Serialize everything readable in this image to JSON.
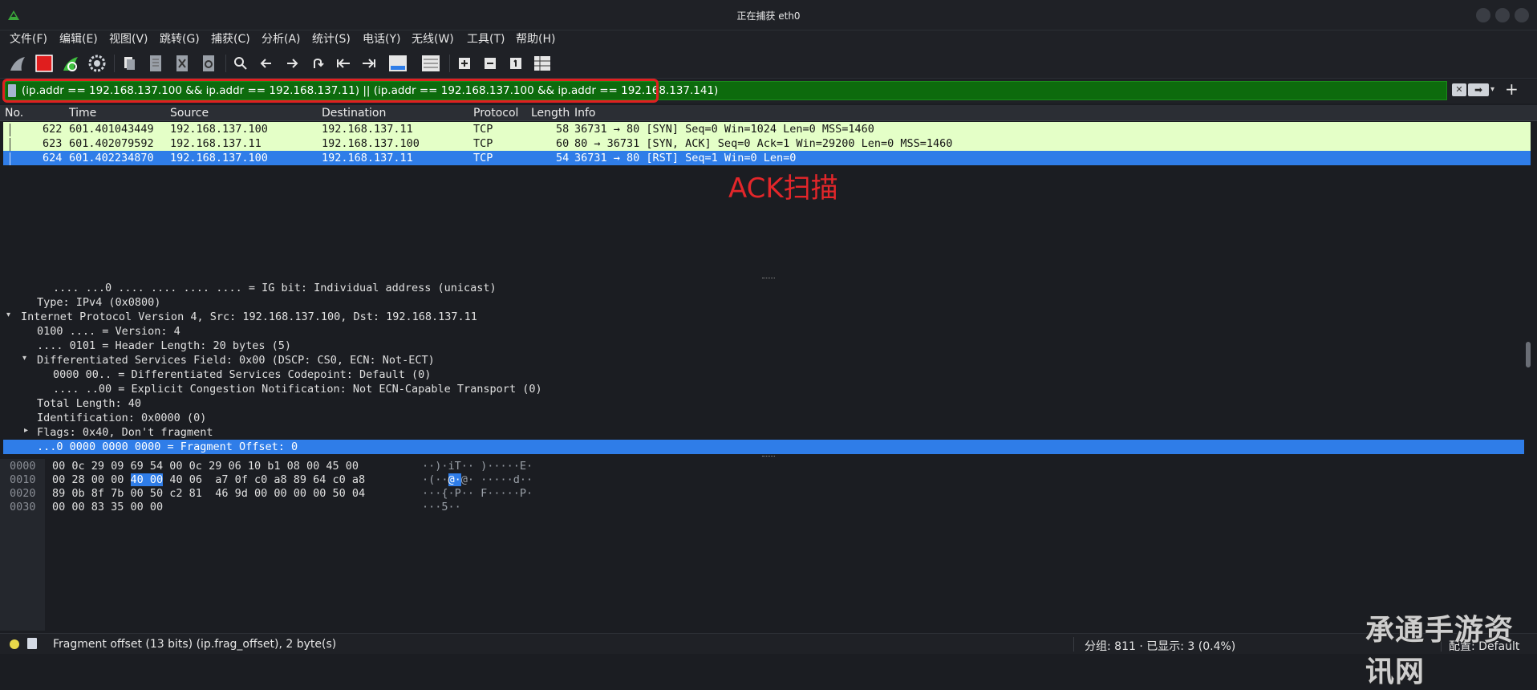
{
  "window": {
    "title": "正在捕获 eth0"
  },
  "menu": [
    "文件(F)",
    "编辑(E)",
    "视图(V)",
    "跳转(G)",
    "捕获(C)",
    "分析(A)",
    "统计(S)",
    "电话(Y)",
    "无线(W)",
    "工具(T)",
    "帮助(H)"
  ],
  "toolbar": {
    "buttons": [
      "start-capture",
      "stop-capture",
      "restart-capture",
      "capture-options",
      "open-file",
      "save-file",
      "close-file",
      "reload-file",
      "find-packet",
      "go-back",
      "go-forward",
      "go-to-packet",
      "first-packet",
      "last-packet",
      "auto-scroll",
      "colorize",
      "zoom-in",
      "zoom-out",
      "normal-size",
      "resize-columns"
    ]
  },
  "filter": {
    "value": "(ip.addr == 192.168.137.100 && ip.addr == 192.168.137.11) || (ip.addr == 192.168.137.100 && ip.addr == 192.168.137.141)",
    "accent": "#0d6b0d",
    "highlight_color": "#e02020"
  },
  "packet_list": {
    "columns": [
      "No.",
      "Time",
      "Source",
      "Destination",
      "Protocol",
      "Length",
      "Info"
    ],
    "rows": [
      {
        "no": "622",
        "time": "601.401043449",
        "source": "192.168.137.100",
        "destination": "192.168.137.11",
        "protocol": "TCP",
        "length": "58",
        "info": "36731 → 80 [SYN] Seq=0 Win=1024 Len=0 MSS=1460",
        "state": "green"
      },
      {
        "no": "623",
        "time": "601.402079592",
        "source": "192.168.137.11",
        "destination": "192.168.137.100",
        "protocol": "TCP",
        "length": "60",
        "info": "80 → 36731 [SYN, ACK] Seq=0 Ack=1 Win=29200 Len=0 MSS=1460",
        "state": "green"
      },
      {
        "no": "624",
        "time": "601.402234870",
        "source": "192.168.137.100",
        "destination": "192.168.137.11",
        "protocol": "TCP",
        "length": "54",
        "info": "36731 → 80 [RST] Seq=1 Win=0 Len=0",
        "state": "selected"
      }
    ]
  },
  "annotation": {
    "text": "ACK扫描",
    "color": "#e3262a"
  },
  "details": [
    {
      "indent": 3,
      "arrow": "",
      "text": ".... ...0 .... .... .... .... = IG bit: Individual address (unicast)"
    },
    {
      "indent": 2,
      "arrow": "",
      "text": "Type: IPv4 (0x0800)"
    },
    {
      "indent": 1,
      "arrow": "▾",
      "text": "Internet Protocol Version 4, Src: 192.168.137.100, Dst: 192.168.137.11"
    },
    {
      "indent": 2,
      "arrow": "",
      "text": "0100 .... = Version: 4"
    },
    {
      "indent": 2,
      "arrow": "",
      "text": ".... 0101 = Header Length: 20 bytes (5)"
    },
    {
      "indent": 2,
      "arrow": "▾",
      "text": "Differentiated Services Field: 0x00 (DSCP: CS0, ECN: Not-ECT)"
    },
    {
      "indent": 3,
      "arrow": "",
      "text": "0000 00.. = Differentiated Services Codepoint: Default (0)"
    },
    {
      "indent": 3,
      "arrow": "",
      "text": ".... ..00 = Explicit Congestion Notification: Not ECN-Capable Transport (0)"
    },
    {
      "indent": 2,
      "arrow": "",
      "text": "Total Length: 40"
    },
    {
      "indent": 2,
      "arrow": "",
      "text": "Identification: 0x0000 (0)"
    },
    {
      "indent": 2,
      "arrow": "▸",
      "text": "Flags: 0x40, Don't fragment"
    },
    {
      "indent": 2,
      "arrow": "",
      "text": "...0 0000 0000 0000 = Fragment Offset: 0",
      "selected": true
    }
  ],
  "bytes": [
    {
      "offset": "0000",
      "hex_a": "00 0c 29 09 69 54 00 0c  29 06 10 b1 08 00 45 00",
      "hex_hl": "",
      "hex_b": "",
      "ascii_a": "··)·iT·· )·····E·",
      "ascii_hl": "",
      "ascii_b": ""
    },
    {
      "offset": "0010",
      "hex_a": "00 28 00 00 ",
      "hex_hl": "40 00",
      "hex_b": " 40 06  a7 0f c0 a8 89 64 c0 a8",
      "ascii_a": "·(··",
      "ascii_hl": "@·",
      "ascii_b": "@· ·····d··"
    },
    {
      "offset": "0020",
      "hex_a": "89 0b 8f 7b 00 50 c2 81  46 9d 00 00 00 00 50 04",
      "hex_hl": "",
      "hex_b": "",
      "ascii_a": "···{·P·· F·····P·",
      "ascii_hl": "",
      "ascii_b": ""
    },
    {
      "offset": "0030",
      "hex_a": "00 00 83 35 00 00",
      "hex_hl": "",
      "hex_b": "",
      "ascii_a": "···5··",
      "ascii_hl": "",
      "ascii_b": ""
    }
  ],
  "status": {
    "field_info": "Fragment offset (13 bits) (ip.frag_offset), 2 byte(s)",
    "packets": "分组: 811 · 已显示: 3 (0.4%)",
    "profile": "配置: Default"
  },
  "watermark": "承通手游资讯网"
}
